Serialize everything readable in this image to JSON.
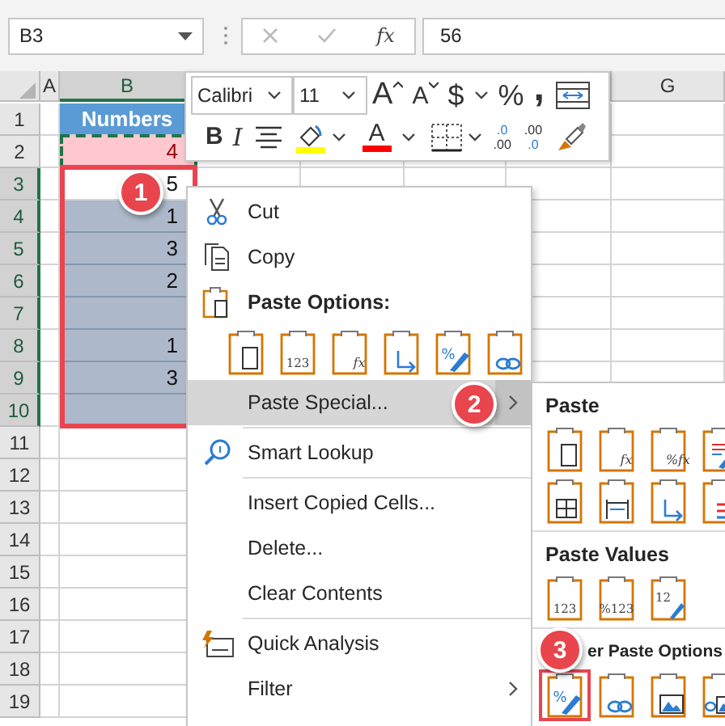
{
  "name_box": {
    "value": "B3"
  },
  "formula_bar": {
    "function_label": "fx",
    "value": "56"
  },
  "columns": [
    {
      "label": "A",
      "selected": false
    },
    {
      "label": "B",
      "selected": true
    },
    {
      "label": "G",
      "selected": false
    }
  ],
  "rows": [
    {
      "number": "1",
      "selected": false,
      "b": {
        "kind": "header",
        "value": "Numbers"
      }
    },
    {
      "number": "2",
      "selected": false,
      "b": {
        "kind": "copied",
        "value": "4"
      }
    },
    {
      "number": "3",
      "selected": true,
      "b": {
        "kind": "plain",
        "value": "5"
      }
    },
    {
      "number": "4",
      "selected": true,
      "b": {
        "kind": "selected",
        "value": "1"
      }
    },
    {
      "number": "5",
      "selected": true,
      "b": {
        "kind": "selected",
        "value": "3"
      }
    },
    {
      "number": "6",
      "selected": true,
      "b": {
        "kind": "selected",
        "value": "2"
      }
    },
    {
      "number": "7",
      "selected": true,
      "b": {
        "kind": "selected"
      }
    },
    {
      "number": "8",
      "selected": true,
      "b": {
        "kind": "selected",
        "value": "1"
      }
    },
    {
      "number": "9",
      "selected": true,
      "b": {
        "kind": "selected",
        "value": "3"
      }
    },
    {
      "number": "10",
      "selected": true,
      "b": {
        "kind": "selected"
      }
    },
    {
      "number": "11",
      "selected": false,
      "b": {
        "kind": "plain"
      }
    },
    {
      "number": "12",
      "selected": false,
      "b": {
        "kind": "plain"
      }
    },
    {
      "number": "13",
      "selected": false,
      "b": {
        "kind": "plain"
      }
    },
    {
      "number": "14",
      "selected": false,
      "b": {
        "kind": "plain"
      }
    },
    {
      "number": "15",
      "selected": false,
      "b": {
        "kind": "plain"
      }
    },
    {
      "number": "16",
      "selected": false,
      "b": {
        "kind": "plain"
      }
    },
    {
      "number": "17",
      "selected": false,
      "b": {
        "kind": "plain"
      }
    },
    {
      "number": "18",
      "selected": false,
      "b": {
        "kind": "plain"
      }
    },
    {
      "number": "19",
      "selected": false,
      "b": {
        "kind": "plain"
      }
    }
  ],
  "selection_callout": {
    "badge": "1"
  },
  "mini_toolbar": {
    "font": {
      "value": "Calibri"
    },
    "size": {
      "value": "11"
    },
    "row_1": [
      {
        "kind": "grow",
        "text": "A"
      },
      {
        "kind": "shrink",
        "text": "A"
      },
      {
        "kind": "currency",
        "text": "$"
      },
      {
        "kind": "dropdown"
      },
      {
        "kind": "percent",
        "text": "%"
      },
      {
        "kind": "comma",
        "text": ","
      },
      {
        "kind": "wrap"
      }
    ],
    "row_2": [
      {
        "kind": "bold",
        "text": "B"
      },
      {
        "kind": "italic",
        "text": "I"
      },
      {
        "kind": "align"
      },
      {
        "kind": "fill",
        "color": "#ffff00"
      },
      {
        "kind": "dropdown"
      },
      {
        "kind": "font-color",
        "text": "A",
        "color": "#ff0000"
      },
      {
        "kind": "dropdown"
      },
      {
        "kind": "borders"
      },
      {
        "kind": "dropdown"
      },
      {
        "kind": "increase-decimal",
        "lines": [
          ".0",
          ".00"
        ]
      },
      {
        "kind": "decrease-decimal",
        "lines": [
          ".00",
          ".0"
        ]
      },
      {
        "kind": "painter"
      }
    ]
  },
  "context_menu": {
    "items": [
      {
        "kind": "cut",
        "label": "Cut"
      },
      {
        "kind": "copy",
        "label": "Copy"
      },
      {
        "kind": "heading",
        "label": "Paste Options:"
      },
      {
        "kind": "icons",
        "icons": [
          {
            "kind": "plain"
          },
          {
            "kind": "values",
            "label": "123"
          },
          {
            "kind": "formula",
            "label": "fx"
          },
          {
            "kind": "transpose"
          },
          {
            "kind": "formatting",
            "label": "%"
          },
          {
            "kind": "link"
          }
        ]
      },
      {
        "kind": "plain",
        "label": "Paste Special...",
        "submenu": true,
        "highlighted": true,
        "badge": "2"
      },
      {
        "kind": "lookup",
        "label": "Smart Lookup",
        "separator_before": true
      },
      {
        "kind": "plain",
        "label": "Insert Copied Cells...",
        "separator_before": true
      },
      {
        "kind": "plain",
        "label": "Delete..."
      },
      {
        "kind": "plain",
        "label": "Clear Contents"
      },
      {
        "kind": "analysis",
        "label": "Quick Analysis",
        "separator_before": true
      },
      {
        "kind": "plain",
        "label": "Filter",
        "submenu": true,
        "highlighted": false
      }
    ]
  },
  "submenu": {
    "sections": [
      {
        "title": "Paste",
        "icons": [
          {
            "kind": "plain"
          },
          {
            "kind": "formula",
            "label": "fx"
          },
          {
            "kind": "formula",
            "label": "%fx"
          },
          {
            "kind": "brush-lines"
          },
          {
            "kind": "grid"
          },
          {
            "kind": "column-width"
          },
          {
            "kind": "transpose"
          },
          {
            "kind": "merge"
          }
        ]
      },
      {
        "title": "Paste Values",
        "icons": [
          {
            "kind": "values",
            "label": "123"
          },
          {
            "kind": "values",
            "label": "%123"
          },
          {
            "kind": "values-brush",
            "label": "12"
          }
        ]
      },
      {
        "title": "er Paste Options",
        "badge": "3",
        "icons": [
          {
            "kind": "formatting",
            "label": "%",
            "highlighted": true
          },
          {
            "kind": "link",
            "highlighted": false
          },
          {
            "kind": "picture",
            "highlighted": false
          },
          {
            "kind": "linked-picture",
            "highlighted": false
          }
        ]
      }
    ]
  }
}
